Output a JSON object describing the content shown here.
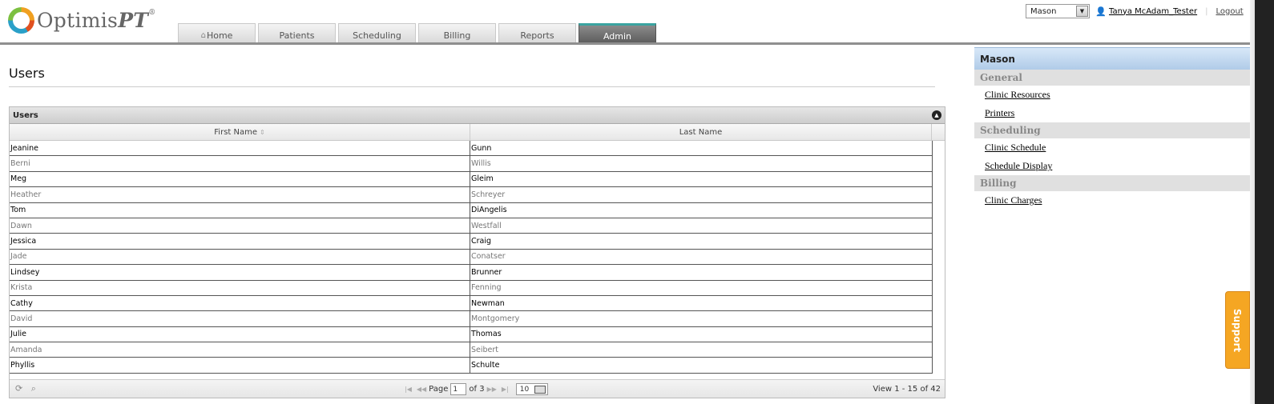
{
  "header": {
    "logo_text_main": "Optimis",
    "logo_text_suffix": "PT",
    "logo_mark": "®",
    "tabs": [
      {
        "label": "Home",
        "icon": "home-icon",
        "active": false
      },
      {
        "label": "Patients",
        "active": false
      },
      {
        "label": "Scheduling",
        "active": false
      },
      {
        "label": "Billing",
        "active": false
      },
      {
        "label": "Reports",
        "active": false
      },
      {
        "label": "Admin",
        "active": true
      }
    ],
    "clinic_select_value": "Mason",
    "user_name": "Tanya McAdam_Tester",
    "separator": "|",
    "logout_label": "Logout"
  },
  "main": {
    "title": "Users",
    "grid": {
      "caption": "Users",
      "columns": [
        "First Name",
        "Last Name"
      ],
      "rows": [
        {
          "first": "Jeanine",
          "last": "Gunn"
        },
        {
          "first": "Berni",
          "last": "Willis"
        },
        {
          "first": "Meg",
          "last": "Gleim"
        },
        {
          "first": "Heather",
          "last": "Schreyer"
        },
        {
          "first": "Tom",
          "last": "DiAngelis"
        },
        {
          "first": "Dawn",
          "last": "Westfall"
        },
        {
          "first": "Jessica",
          "last": "Craig"
        },
        {
          "first": "Jade",
          "last": "Conatser"
        },
        {
          "first": "Lindsey",
          "last": "Brunner"
        },
        {
          "first": "Krista",
          "last": "Fenning"
        },
        {
          "first": "Cathy",
          "last": "Newman"
        },
        {
          "first": "David",
          "last": "Montgomery"
        },
        {
          "first": "Julie",
          "last": "Thomas"
        },
        {
          "first": "Amanda",
          "last": "Seibert"
        },
        {
          "first": "Phyllis",
          "last": "Schulte"
        }
      ],
      "pager": {
        "page_label": "Page",
        "page_value": "1",
        "of_label": "of 3",
        "page_size": "10",
        "view_text": "View 1 - 15 of 42"
      }
    }
  },
  "sidebar": {
    "title": "Mason",
    "sections": [
      {
        "label": "General",
        "links": [
          "Clinic Resources",
          "Printers"
        ]
      },
      {
        "label": "Scheduling",
        "links": [
          "Clinic Schedule",
          "Schedule Display"
        ]
      },
      {
        "label": "Billing",
        "links": [
          "Clinic Charges"
        ]
      }
    ]
  },
  "support_label": "Support",
  "colors": {
    "active_tab_accent": "#3aa3a0",
    "support": "#f5a623",
    "sidebar_head": "#b0cbe8"
  }
}
